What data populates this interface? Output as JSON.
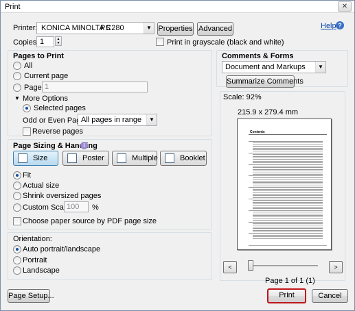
{
  "window": {
    "title": "Print",
    "close_glyph": "✕"
  },
  "top": {
    "printer_label": "Printer:",
    "printer_blurred": "KONICA MINOLTA C280",
    "printer_value": "PS",
    "properties_label": "Properties",
    "advanced_label": "Advanced",
    "help_label": "Help",
    "copies_label": "Copies:",
    "copies_value": "1",
    "grayscale_label": "Print in grayscale (black and white)"
  },
  "pages_to_print": {
    "title": "Pages to Print",
    "all": "All",
    "current_page": "Current page",
    "pages": "Pages",
    "pages_value": "1",
    "more_options": "More Options",
    "selected_pages": "Selected pages",
    "odd_even_label": "Odd or Even Pages:",
    "odd_even_value": "All pages in range",
    "reverse_pages": "Reverse pages"
  },
  "sizing": {
    "title": "Page Sizing & Handling",
    "size_btn": "Size",
    "poster_btn": "Poster",
    "multiple_btn": "Multiple",
    "booklet_btn": "Booklet",
    "fit": "Fit",
    "actual_size": "Actual size",
    "shrink": "Shrink oversized pages",
    "custom_scale": "Custom Scale:",
    "custom_scale_value": "100",
    "percent": "%",
    "choose_source": "Choose paper source by PDF page size"
  },
  "orientation": {
    "title": "Orientation:",
    "auto": "Auto portrait/landscape",
    "portrait": "Portrait",
    "landscape": "Landscape"
  },
  "comments": {
    "title": "Comments & Forms",
    "value": "Document and Markups",
    "summarize_btn": "Summarize Comments"
  },
  "preview": {
    "scale": "Scale:  92%",
    "dimensions": "215.9 x 279.4 mm",
    "page_heading": "Contents",
    "page_info": "Page 1 of 1 (1)",
    "prev_glyph": "<",
    "next_glyph": ">"
  },
  "footer": {
    "page_setup": "Page Setup...",
    "print": "Print",
    "cancel": "Cancel"
  },
  "icons": {
    "help": "?",
    "info": "i"
  }
}
